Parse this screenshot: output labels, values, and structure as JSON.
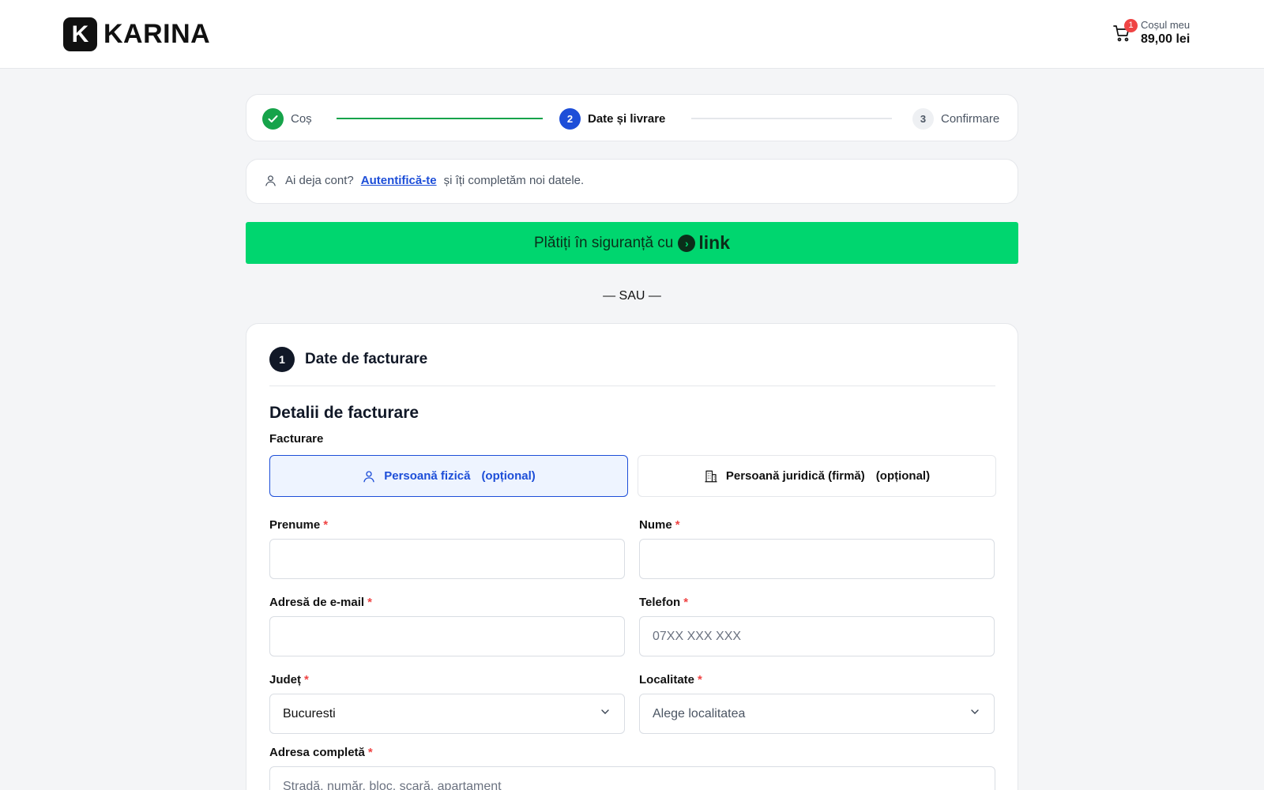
{
  "header": {
    "logo_letter": "K",
    "logo_text": "KARINA",
    "cart": {
      "badge": "1",
      "label": "Coșul meu",
      "total": "89,00 lei"
    }
  },
  "stepper": {
    "steps": [
      {
        "number": "✓",
        "label": "Coș",
        "state": "done"
      },
      {
        "number": "2",
        "label": "Date și livrare",
        "state": "active"
      },
      {
        "number": "3",
        "label": "Confirmare",
        "state": "upcoming"
      }
    ]
  },
  "login": {
    "question": "Ai deja cont?",
    "link": "Autentifică-te",
    "suffix": "și îți completăm noi datele."
  },
  "pay_link": {
    "label": "Plătiți în siguranță cu",
    "brand": "link"
  },
  "separator": "— SAU —",
  "billing": {
    "section_number": "1",
    "section_title": "Date de facturare",
    "subtitle": "Detalii de facturare",
    "type_label": "Facturare",
    "types": [
      {
        "label": "Persoană fizică",
        "optional": "(opțional)",
        "selected": true
      },
      {
        "label": "Persoană juridică (firmă)",
        "optional": "(opțional)",
        "selected": false
      }
    ],
    "fields": {
      "first_name": {
        "label": "Prenume",
        "value": "",
        "placeholder": ""
      },
      "last_name": {
        "label": "Nume",
        "value": "",
        "placeholder": ""
      },
      "email": {
        "label": "Adresă de e-mail",
        "value": "",
        "placeholder": ""
      },
      "phone": {
        "label": "Telefon",
        "value": "",
        "placeholder": "07XX XXX XXX"
      },
      "county": {
        "label": "Județ",
        "value": "Bucuresti"
      },
      "city": {
        "label": "Localitate",
        "placeholder": "Alege localitatea"
      },
      "address": {
        "label": "Adresa completă",
        "placeholder": "Stradă, număr, bloc, scară, apartament"
      }
    },
    "required_mark": "*"
  },
  "colors": {
    "accent_blue": "#1d4ed8",
    "success_green": "#16a34a",
    "link_green": "#00d66f",
    "required_red": "#ef4444"
  }
}
